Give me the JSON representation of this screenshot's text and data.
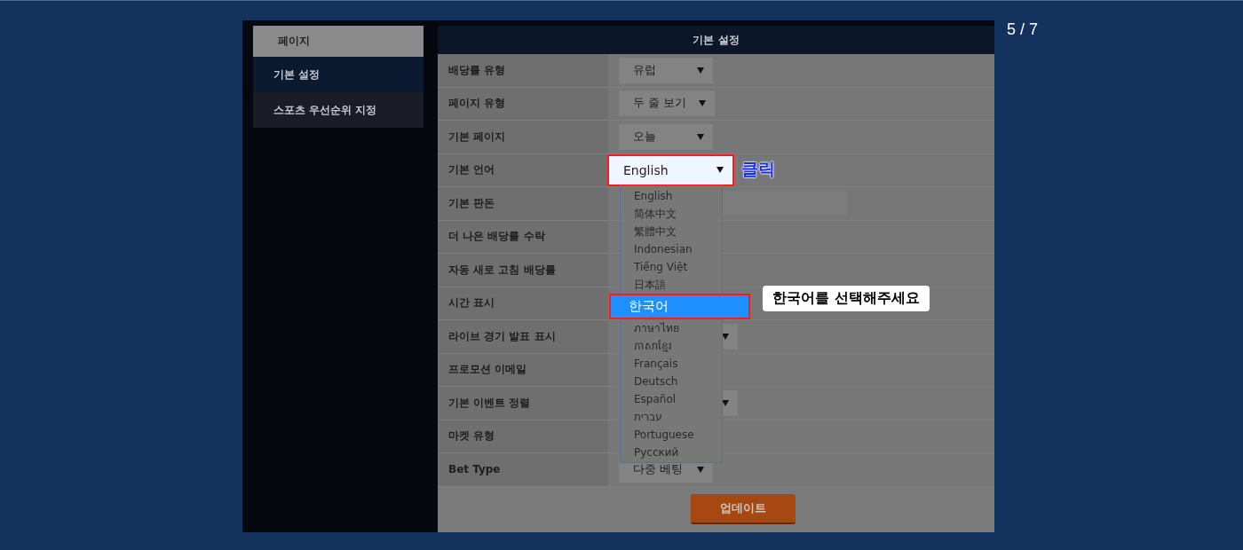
{
  "counter": "5 / 7",
  "sidebar": {
    "title": "페이지",
    "items": [
      {
        "label": "기본 설정",
        "selected": true
      },
      {
        "label": "스포츠 우선순위 지정",
        "selected": false
      }
    ]
  },
  "panel": {
    "title": "기본 설정",
    "rows": [
      {
        "label": "배당률 유형",
        "kind": "select",
        "value": "유럽",
        "highlighted": false
      },
      {
        "label": "페이지 유형",
        "kind": "select",
        "value": "두 줄 보기",
        "highlighted": false
      },
      {
        "label": "기본 페이지",
        "kind": "select",
        "value": "오늘",
        "highlighted": false
      },
      {
        "label": "기본 언어",
        "kind": "select",
        "value": "English",
        "highlighted": true
      },
      {
        "label": "기본 판돈",
        "kind": "input"
      },
      {
        "label": "더 나은 배당률 수락",
        "kind": "none"
      },
      {
        "label": "자동 새로 고침 배당률",
        "kind": "none"
      },
      {
        "label": "시간 표시",
        "kind": "none"
      },
      {
        "label": "라이브 경기 발표 표시",
        "kind": "select",
        "highlighted": false
      },
      {
        "label": "프로모션 이메일",
        "kind": "none"
      },
      {
        "label": "기본 이벤트 정렬",
        "kind": "select",
        "highlighted": false
      },
      {
        "label": "마켓 유형",
        "kind": "none"
      },
      {
        "label": "Bet Type",
        "kind": "select",
        "value": "다중 베팅",
        "highlighted": false
      }
    ],
    "button": "업데이트"
  },
  "dropdown": {
    "options": [
      {
        "label": "English",
        "selected": false
      },
      {
        "label": "简体中文",
        "selected": false
      },
      {
        "label": "繁體中文",
        "selected": false
      },
      {
        "label": "Indonesian",
        "selected": false
      },
      {
        "label": "Tiếng Việt",
        "selected": false
      },
      {
        "label": "日本語",
        "selected": false
      },
      {
        "label": "한국어",
        "selected": true
      },
      {
        "label": "ภาษาไทย",
        "selected": false
      },
      {
        "label": "ភាសាខ្មែរ",
        "selected": false
      },
      {
        "label": "Français",
        "selected": false
      },
      {
        "label": "Deutsch",
        "selected": false
      },
      {
        "label": "Español",
        "selected": false
      },
      {
        "label": "עברית",
        "selected": false
      },
      {
        "label": "Portuguese",
        "selected": false
      },
      {
        "label": "Русский",
        "selected": false
      }
    ]
  },
  "annotations": [
    {
      "kind": "label",
      "text": "클릭"
    },
    {
      "kind": "callout",
      "text": "한국어를 선택해주세요"
    }
  ]
}
